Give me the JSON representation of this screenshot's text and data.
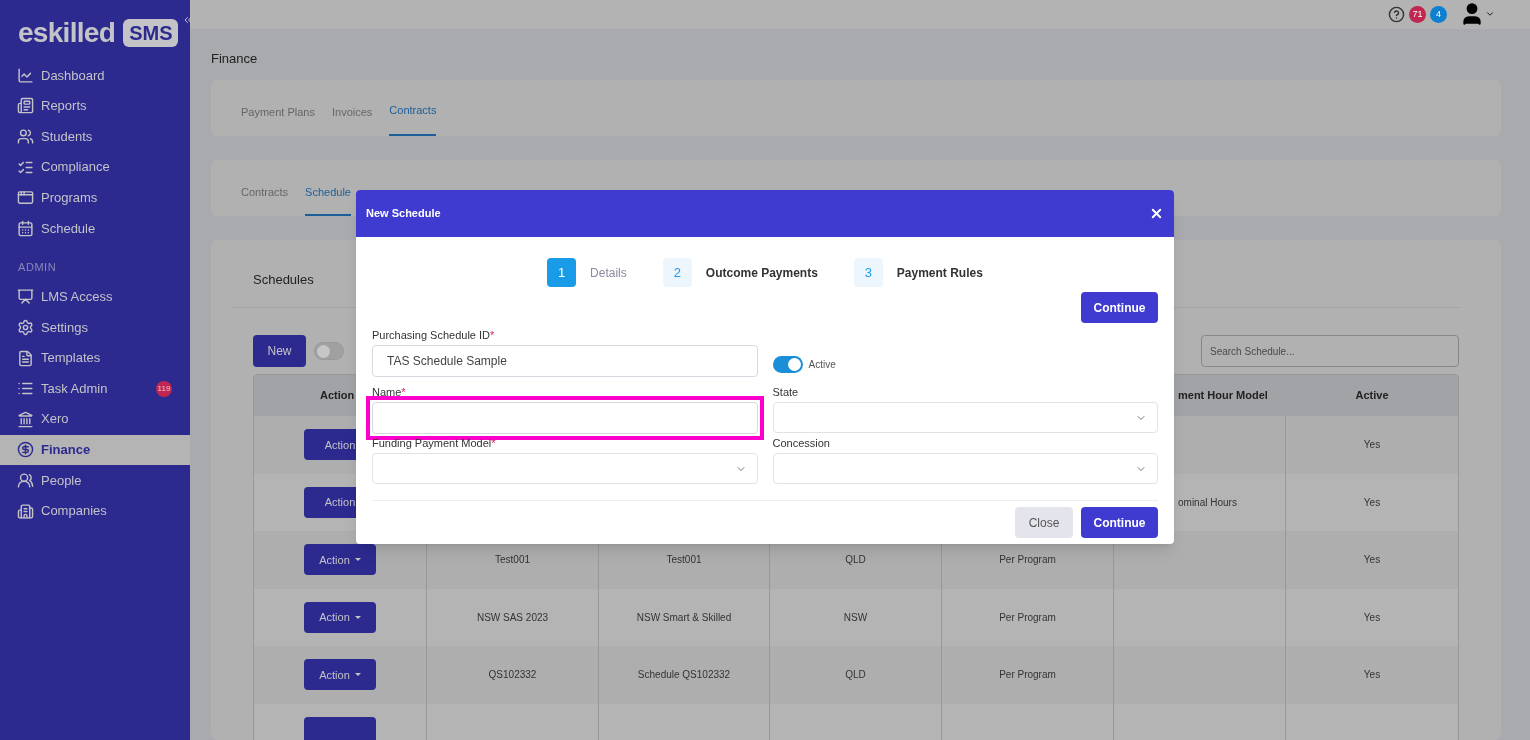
{
  "logo": {
    "brand": "eskilled",
    "product": "SMS"
  },
  "sidebar": {
    "items": [
      {
        "kind": "item",
        "label": "Dashboard",
        "selected": false
      },
      {
        "kind": "item",
        "label": "Reports",
        "selected": false
      },
      {
        "kind": "item",
        "label": "Students",
        "selected": false
      },
      {
        "kind": "item",
        "label": "Compliance",
        "selected": false
      },
      {
        "kind": "item",
        "label": "Programs",
        "selected": false
      },
      {
        "kind": "item",
        "label": "Schedule",
        "selected": false
      },
      {
        "kind": "heading",
        "label": "ADMIN"
      },
      {
        "kind": "item",
        "label": "LMS Access",
        "selected": false
      },
      {
        "kind": "item",
        "label": "Settings",
        "selected": false
      },
      {
        "kind": "item",
        "label": "Templates",
        "selected": false
      },
      {
        "kind": "item",
        "label": "Task Admin",
        "selected": false,
        "badge": "119"
      },
      {
        "kind": "item",
        "label": "Xero",
        "selected": false
      },
      {
        "kind": "item",
        "label": "Finance",
        "selected": true
      },
      {
        "kind": "item",
        "label": "People",
        "selected": false
      },
      {
        "kind": "item",
        "label": "Companies",
        "selected": false
      }
    ]
  },
  "header": {
    "notifications": [
      {
        "count": "71",
        "color": "#c0264f"
      },
      {
        "count": "4",
        "color": "#0f7fd0"
      }
    ]
  },
  "page_title": "Finance",
  "tabs": [
    {
      "label": "Payment Plans",
      "selected": false
    },
    {
      "label": "Invoices",
      "selected": false
    },
    {
      "label": "Contracts",
      "selected": true
    }
  ],
  "subtabs": [
    {
      "label": "Contracts",
      "selected": false
    },
    {
      "label": "Schedule",
      "selected": true
    }
  ],
  "schedules": {
    "title": "Schedules",
    "new_button": "New",
    "toggle_on": false,
    "search": {
      "placeholder": "Search Schedule..."
    },
    "action_column": "Action",
    "columns": [
      "",
      "",
      "",
      "",
      "ment Hour Model",
      "Active"
    ],
    "rows": [
      {
        "action": "Action",
        "caret": false,
        "cells": [
          "",
          "",
          "",
          "",
          "",
          "Yes"
        ]
      },
      {
        "action": "Action",
        "caret": false,
        "cells": [
          "",
          "",
          "",
          "",
          "ominal Hours",
          "Yes"
        ]
      },
      {
        "action": "Action",
        "caret": true,
        "cells": [
          "Test001",
          "Test001",
          "QLD",
          "Per Program",
          "",
          "Yes"
        ]
      },
      {
        "action": "Action",
        "caret": true,
        "cells": [
          "NSW SAS 2023",
          "NSW Smart & Skilled",
          "NSW",
          "Per Program",
          "",
          "Yes"
        ]
      },
      {
        "action": "Action",
        "caret": true,
        "cells": [
          "QS102332",
          "Schedule QS102332",
          "QLD",
          "Per Program",
          "",
          "Yes"
        ]
      },
      {
        "action": "",
        "caret": false,
        "cells": [
          "",
          "",
          "",
          "",
          "",
          ""
        ]
      }
    ]
  },
  "dialog": {
    "title": "New Schedule",
    "steps": [
      {
        "number": "1",
        "label": "Details",
        "selected": true
      },
      {
        "number": "2",
        "label": "Outcome Payments",
        "selected": false
      },
      {
        "number": "3",
        "label": "Payment Rules",
        "selected": false
      }
    ],
    "top_button": "Continue",
    "fields": [
      {
        "kind": "text",
        "label": "Purchasing Schedule ID",
        "required_mark": "*",
        "value": "TAS Schedule Sample",
        "highlighted": false
      },
      {
        "kind": "toggle",
        "label": "Active",
        "on": true
      },
      {
        "kind": "text",
        "label": "Name",
        "required_mark": "*",
        "highlighted": true
      },
      {
        "kind": "select",
        "label": "State",
        "highlighted": false
      },
      {
        "kind": "select",
        "label": "Funding Payment Model",
        "required_mark": "*",
        "highlighted": false
      },
      {
        "kind": "select",
        "label": "Concession",
        "highlighted": false
      }
    ],
    "buttons": [
      {
        "label": "Close",
        "kind": "secondary"
      },
      {
        "label": "Continue",
        "kind": "primary"
      }
    ]
  }
}
